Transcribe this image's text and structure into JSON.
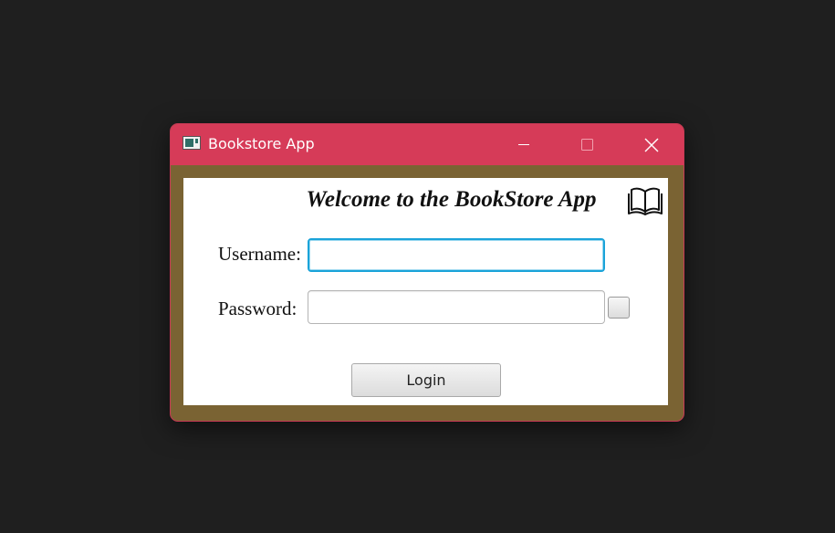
{
  "window": {
    "title": "Bookstore App",
    "icons": {
      "app": "app-window-icon",
      "minimize": "minimize-icon",
      "maximize": "maximize-icon",
      "close": "close-icon",
      "brand": "open-book-icon"
    },
    "colors": {
      "titlebar": "#d63b58",
      "frame": "#7a6333",
      "content": "#ffffff",
      "focus_border": "#1aa3d9"
    }
  },
  "form": {
    "heading": "Welcome to the BookStore App",
    "username_label": "Username:",
    "username_value": "",
    "password_label": "Password:",
    "password_value": "",
    "show_password_checked": false,
    "login_label": "Login"
  }
}
